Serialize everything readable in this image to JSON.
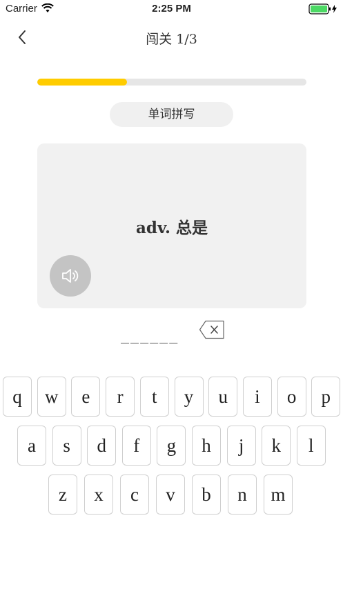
{
  "status_bar": {
    "carrier": "Carrier",
    "time": "2:25 PM",
    "battery_color": "#4cd964"
  },
  "nav": {
    "title": "闯关 1/3"
  },
  "progress": {
    "fraction": 0.333,
    "color": "#ffcc00"
  },
  "mode": {
    "label": "单词拼写"
  },
  "card": {
    "word": "adv. 总是"
  },
  "answer": {
    "blanks": "______"
  },
  "keyboard": {
    "row1": [
      "q",
      "w",
      "e",
      "r",
      "t",
      "y",
      "u",
      "i",
      "o",
      "p"
    ],
    "row2": [
      "a",
      "s",
      "d",
      "f",
      "g",
      "h",
      "j",
      "k",
      "l"
    ],
    "row3": [
      "z",
      "x",
      "c",
      "v",
      "b",
      "n",
      "m"
    ]
  }
}
